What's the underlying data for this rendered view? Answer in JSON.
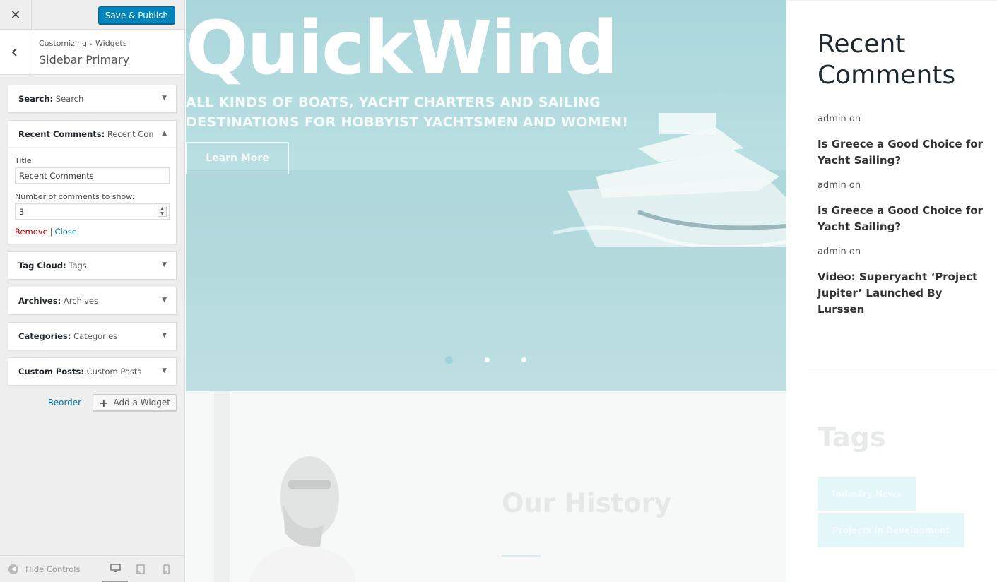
{
  "customizer": {
    "close_icon": "close-icon",
    "save_label": "Save & Publish",
    "breadcrumb": {
      "root": "Customizing",
      "sep": "▸",
      "parent": "Widgets"
    },
    "section_title": "Sidebar Primary",
    "widgets": [
      {
        "type": "Search:",
        "title": " Search",
        "open": false
      },
      {
        "type": "Recent Comments:",
        "title": " Recent Com...",
        "open": true
      },
      {
        "type": "Tag Cloud:",
        "title": " Tags",
        "open": false
      },
      {
        "type": "Archives:",
        "title": " Archives",
        "open": false
      },
      {
        "type": "Categories:",
        "title": " Categories",
        "open": false
      },
      {
        "type": "Custom Posts:",
        "title": " Custom Posts",
        "open": false
      }
    ],
    "form": {
      "title_label": "Title:",
      "title_value": "Recent Comments",
      "number_label": "Number of comments to show:",
      "number_value": "3",
      "remove": "Remove",
      "pipe": "|",
      "close": "Close"
    },
    "reorder": "Reorder",
    "add_widget": "Add a Widget",
    "hide_controls": "Hide Controls",
    "devices": [
      "desktop-icon",
      "tablet-icon",
      "mobile-icon"
    ],
    "accent_color": "#0085ba"
  },
  "preview": {
    "hero": {
      "title": "QuickWind",
      "tagline": "ALL KINDS OF BOATS, YACHT CHARTERS AND SAILING DESTINATIONS FOR HOBBYIST YACHTSMEN AND WOMEN!",
      "button": "Learn More",
      "slides": 3,
      "active_slide": 1
    },
    "history": "Our History",
    "sidebar": {
      "recent_comments_title": "Recent Comments",
      "comments": [
        {
          "author": "admin on",
          "post": "Is Greece a Good Choice for Yacht Sailing?"
        },
        {
          "author": "admin on",
          "post": "Is Greece a Good Choice for Yacht Sailing?"
        },
        {
          "author": "admin on",
          "post": "Video: Superyacht ‘Project Jupiter’ Launched By Lurssen"
        }
      ],
      "tags_title": "Tags",
      "tags": [
        "Industry News",
        "Projects in Development"
      ]
    }
  }
}
